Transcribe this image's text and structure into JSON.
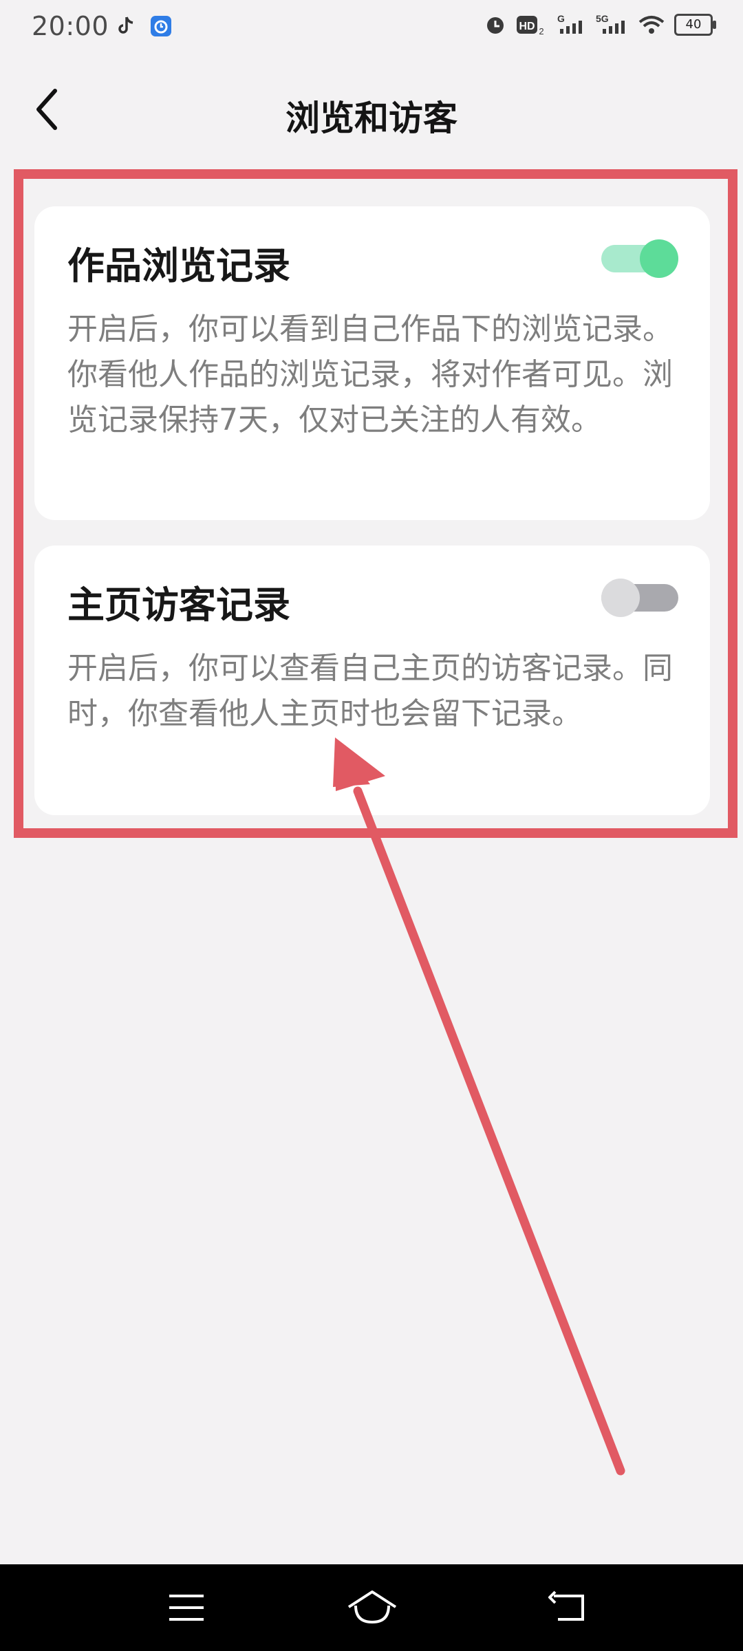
{
  "status_bar": {
    "time": "20:00",
    "left_icons": [
      "tiktok-icon",
      "alarm-app-icon"
    ],
    "right_icons": [
      "alarm-clock-icon",
      "hd-icon",
      "signal-g-icon",
      "signal-5g-icon",
      "wifi-icon",
      "battery-icon"
    ],
    "hd_label": "HD",
    "g_label": "G",
    "fiveg_label": "5G",
    "battery_level": "40"
  },
  "header": {
    "title": "浏览和访客",
    "back_icon": "chevron-left-icon"
  },
  "settings": [
    {
      "title": "作品浏览记录",
      "description": "开启后，你可以看到自己作品下的浏览记录。你看他人作品的浏览记录，将对作者可见。浏览记录保持7天，仅对已关注的人有效。",
      "enabled": true
    },
    {
      "title": "主页访客记录",
      "description": "开启后，你可以查看自己主页的访客记录。同时，你查看他人主页时也会留下记录。",
      "enabled": false
    }
  ],
  "colors": {
    "annotation_red": "#e15a63",
    "toggle_on": "#5ddc99",
    "toggle_off": "#a9a9ae",
    "background": "#f3f2f3"
  },
  "nav_bar": {
    "icons": [
      "menu-icon",
      "home-icon",
      "back-icon"
    ]
  }
}
